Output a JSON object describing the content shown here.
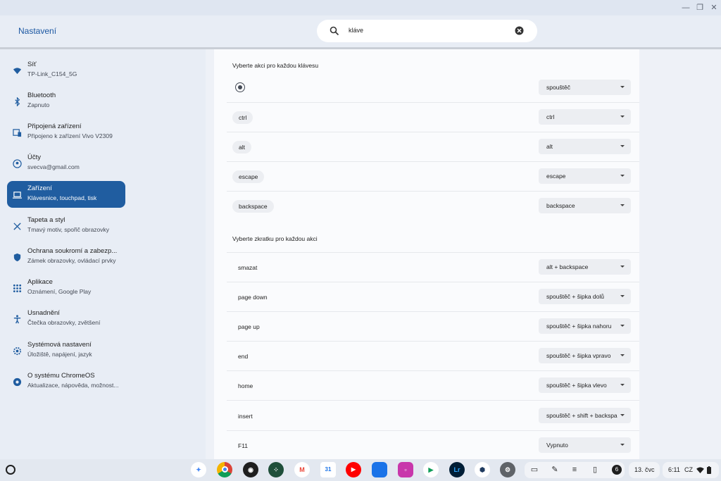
{
  "window": {
    "title": "Nastavení"
  },
  "search": {
    "value": "kláve"
  },
  "sidebar": {
    "items": [
      {
        "title": "Síť",
        "subtitle": "TP-Link_C154_5G",
        "icon": "wifi-icon"
      },
      {
        "title": "Bluetooth",
        "subtitle": "Zapnuto",
        "icon": "bluetooth-icon"
      },
      {
        "title": "Připojená zařízení",
        "subtitle": "Připojeno k zařízení Vivo V2309",
        "icon": "connected-devices-icon"
      },
      {
        "title": "Účty",
        "subtitle": "svecva@gmail.com",
        "icon": "account-icon"
      },
      {
        "title": "Zařízení",
        "subtitle": "Klávesnice, touchpad, tisk",
        "icon": "laptop-icon"
      },
      {
        "title": "Tapeta a styl",
        "subtitle": "Tmavý motiv, spořič obrazovky",
        "icon": "palette-icon"
      },
      {
        "title": "Ochrana soukromí a zabezp...",
        "subtitle": "Zámek obrazovky, ovládací prvky",
        "icon": "shield-icon"
      },
      {
        "title": "Aplikace",
        "subtitle": "Oznámení, Google Play",
        "icon": "apps-grid-icon"
      },
      {
        "title": "Usnadnění",
        "subtitle": "Čtečka obrazovky, zvětšení",
        "icon": "accessibility-icon"
      },
      {
        "title": "Systémová nastavení",
        "subtitle": "Úložiště, napájení, jazyk",
        "icon": "gear-icon"
      },
      {
        "title": "O systému ChromeOS",
        "subtitle": "Aktualizace, nápověda, možnost...",
        "icon": "chromeos-icon"
      }
    ],
    "active_index": 4
  },
  "main": {
    "key_section_title": "Vyberte akci pro každou klávesu",
    "keys": [
      {
        "key": "",
        "is_radio_icon": true,
        "action": "spouštěč"
      },
      {
        "key": "ctrl",
        "action": "ctrl"
      },
      {
        "key": "alt",
        "action": "alt"
      },
      {
        "key": "escape",
        "action": "escape"
      },
      {
        "key": "backspace",
        "action": "backspace"
      }
    ],
    "shortcut_section_title": "Vyberte zkratku pro každou akci",
    "shortcuts": [
      {
        "action": "smazat",
        "shortcut": "alt + backspace"
      },
      {
        "action": "page down",
        "shortcut": "spouštěč + šipka dolů"
      },
      {
        "action": "page up",
        "shortcut": "spouštěč + šipka nahoru"
      },
      {
        "action": "end",
        "shortcut": "spouštěč + šipka vpravo"
      },
      {
        "action": "home",
        "shortcut": "spouštěč + šipka vlevo"
      },
      {
        "action": "insert",
        "shortcut": "spouštěč + shift + backspa"
      },
      {
        "action": "F11",
        "shortcut": "Vypnuto"
      }
    ]
  },
  "shelf": {
    "apps": [
      {
        "name": "gemini-app-icon",
        "color": "#ffffff"
      },
      {
        "name": "chrome-app-icon",
        "color": "#db4437"
      },
      {
        "name": "podcast-app-icon",
        "color": "#1f1f1f"
      },
      {
        "name": "dots-app-icon",
        "color": "#1f4f3a"
      },
      {
        "name": "gmail-app-icon",
        "color": "#ffffff"
      },
      {
        "name": "calendar-app-icon",
        "color": "#ffffff"
      },
      {
        "name": "youtube-app-icon",
        "color": "#ff0000"
      },
      {
        "name": "files-app-icon",
        "color": "#1a73e8"
      },
      {
        "name": "photo-app-icon",
        "color": "#c837ab"
      },
      {
        "name": "play-store-app-icon",
        "color": "#ffffff"
      },
      {
        "name": "lightroom-app-icon",
        "color": "#001e36"
      },
      {
        "name": "hex-app-icon",
        "color": "#ffffff"
      },
      {
        "name": "settings-app-icon",
        "color": "#5f6368"
      }
    ],
    "lightroom_label": "Lr",
    "notification_count": "6",
    "date": "13. čvc",
    "time": "6:11",
    "ime": "CZ"
  }
}
